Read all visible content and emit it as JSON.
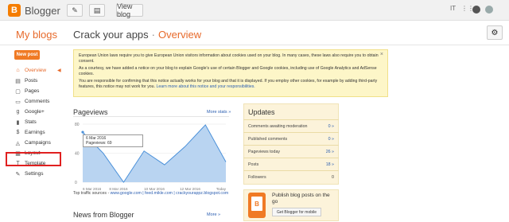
{
  "topbar": {
    "brand": "Blogger",
    "view_blog": "View blog",
    "user_initials": "IT"
  },
  "header": {
    "my_blogs": "My blogs",
    "blog_name": "Crack your apps",
    "separator": "·",
    "section": "Overview"
  },
  "sidebar": {
    "new_post": "New post",
    "items": [
      {
        "label": "Overview",
        "icon": "home-icon",
        "glyph": "⌂"
      },
      {
        "label": "Posts",
        "icon": "posts-icon",
        "glyph": "▤"
      },
      {
        "label": "Pages",
        "icon": "pages-icon",
        "glyph": "▢"
      },
      {
        "label": "Comments",
        "icon": "comments-icon",
        "glyph": "▭"
      },
      {
        "label": "Google+",
        "icon": "google-plus-icon",
        "glyph": "g"
      },
      {
        "label": "Stats",
        "icon": "stats-icon",
        "glyph": "▮"
      },
      {
        "label": "Earnings",
        "icon": "earnings-icon",
        "glyph": "$"
      },
      {
        "label": "Campaigns",
        "icon": "campaigns-icon",
        "glyph": "◬"
      },
      {
        "label": "Layout",
        "icon": "layout-icon",
        "glyph": "▦"
      },
      {
        "label": "Template",
        "icon": "template-icon",
        "glyph": "T"
      },
      {
        "label": "Settings",
        "icon": "settings-icon",
        "glyph": "✎"
      }
    ]
  },
  "notice": {
    "p1": "European Union laws require you to give European Union visitors information about cookies used on your blog. In many cases, these laws also require you to obtain consent.",
    "p2": "As a courtesy, we have added a notice on your blog to explain Google's use of certain Blogger and Google cookies, including use of Google Analytics and AdSense cookies.",
    "p3": "You are responsible for confirming that this notice actually works for your blog and that it is displayed. If you employ other cookies, for example by adding third-party features, this notice may not work for you.",
    "learn_more": "Learn more about this notice and your responsibilities.",
    "close": "×"
  },
  "pageviews": {
    "title": "Pageviews",
    "more": "More stats »",
    "tooltip_date": "6 Mar 2016",
    "tooltip_value": "Pageviews: 69",
    "traffic_label": "Top traffic sources - ",
    "traffic_links": "www.google.com | feed.mikle.com | crackyourappz.blogspot.com"
  },
  "chart_data": {
    "type": "area",
    "categories": [
      "6 Mar 2016",
      "8 Mar 2016",
      "10 Mar 2016",
      "12 Mar 2016",
      "Today"
    ],
    "points": [
      69,
      40,
      0,
      43,
      24,
      49,
      79,
      28
    ],
    "ylim": [
      0,
      80
    ],
    "yticks": [
      "80",
      "40",
      "0"
    ],
    "color": "#4a90d9"
  },
  "updates": {
    "title": "Updates",
    "rows": [
      {
        "label": "Comments awaiting moderation",
        "value": "0 »"
      },
      {
        "label": "Published comments",
        "value": "0 »"
      },
      {
        "label": "Pageviews today",
        "value": "26 »"
      },
      {
        "label": "Posts",
        "value": "18 »"
      },
      {
        "label": "Followers",
        "value": "0"
      }
    ]
  },
  "promo": {
    "text": "Publish blog posts on the go",
    "button": "Get Blogger for mobile"
  },
  "news": {
    "title": "News from Blogger",
    "more": "More »"
  }
}
